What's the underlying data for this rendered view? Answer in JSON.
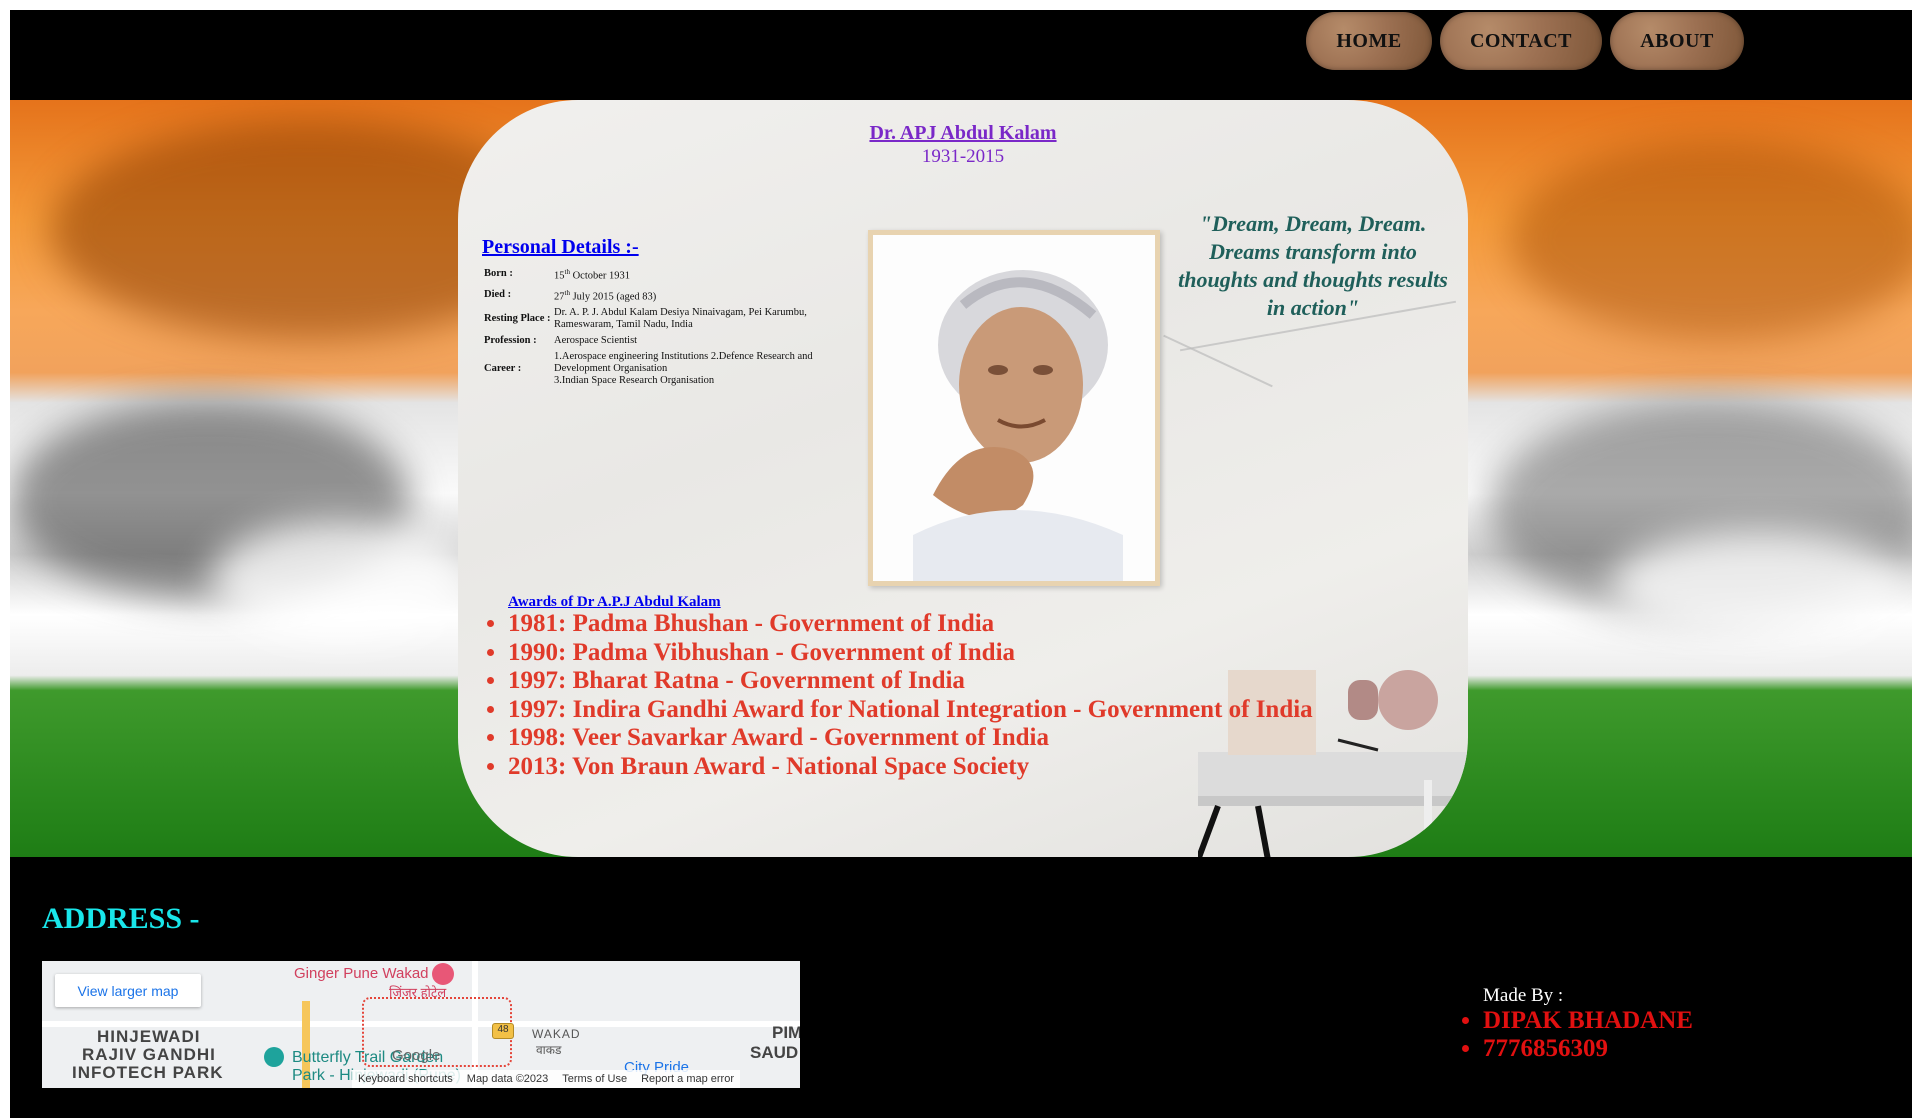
{
  "nav": {
    "home": "HOME",
    "contact": "CONTACT",
    "about": "ABOUT"
  },
  "hero": {
    "name": "Dr. APJ Abdul Kalam",
    "years": "1931-2015"
  },
  "personal": {
    "heading": "Personal Details :-",
    "born_label": "Born :",
    "born_day": "15",
    "born_sup": "th",
    "born_rest": " October 1931",
    "died_label": "Died :",
    "died_day": "27",
    "died_sup": "th",
    "died_rest": " July 2015 (aged 83)",
    "resting_label": "Resting Place :",
    "resting_value": "Dr. A. P. J. Abdul Kalam Desiya Ninaivagam, Pei Karumbu, Rameswaram, Tamil Nadu, India",
    "profession_label": "Profession :",
    "profession_value": "Aerospace Scientist",
    "career_label": "Career :",
    "career_line1": "1.Aerospace engineering Institutions 2.Defence Research and Development Organisation",
    "career_line2": "3.Indian Space Research Organisation"
  },
  "quote": "\"Dream, Dream, Dream. Dreams transform into thoughts and thoughts results in action\"",
  "awards": {
    "heading": "Awards of Dr A.P.J Abdul Kalam",
    "items": [
      "1981: Padma Bhushan - Government of India",
      "1990: Padma Vibhushan - Government of India",
      "1997: Bharat Ratna - Government of India",
      "1997: Indira Gandhi Award for National Integration - Government of India",
      "1998: Veer Savarkar Award - Government of India",
      "2013: Von Braun Award - National Space Society"
    ]
  },
  "footer": {
    "address_heading": "ADDRESS -",
    "map": {
      "button": "View larger map",
      "place1": "Ginger Pune Wakad",
      "place1_hindi": "जिंजर होटेल",
      "area1": "HINJEWADI",
      "area2": "RAJIV GANDHI",
      "area3": "INFOTECH PARK",
      "wakad": "WAKAD",
      "wakad_hindi": "वाकड",
      "butterfly": "Butterfly Trail Garden",
      "park": "Park - Hinjewadi (Pune)",
      "city_pride": "City Pride",
      "pim": "PIM",
      "saud": "SAUD",
      "road_number": "48",
      "google": "Google",
      "keyboard": "Keyboard shortcuts",
      "map_data": "Map data ©2023",
      "terms": "Terms of Use",
      "report": "Report a map error"
    },
    "made_by": "Made By :",
    "author": "DIPAK BHADANE",
    "phone": "7776856309"
  },
  "colors": {
    "name": "#7a28c8",
    "heading_link": "#0000ee",
    "quote": "#1f5f5a",
    "awards": "#e03a2a",
    "address": "#19e6ea",
    "author": "#e11010"
  }
}
